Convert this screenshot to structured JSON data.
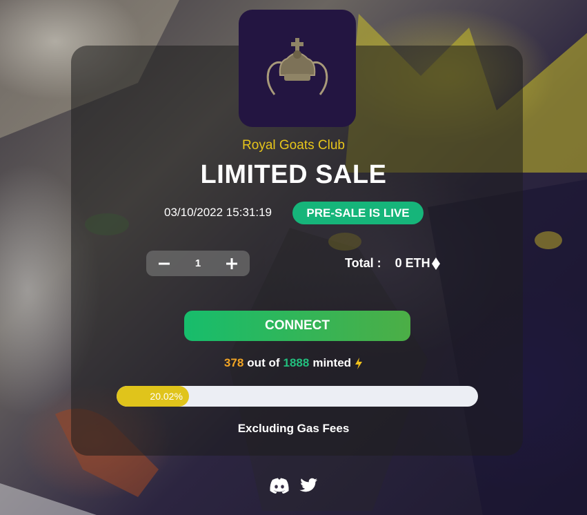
{
  "header": {
    "club_name": "Royal Goats Club",
    "title": "LIMITED SALE"
  },
  "sale": {
    "datetime": "03/10/2022 15:31:19",
    "status": "PRE-SALE IS LIVE"
  },
  "mint": {
    "quantity": "1",
    "minus_label": "−",
    "plus_label": "+",
    "total_label": "Total :",
    "total_value": "0 ETH"
  },
  "actions": {
    "connect_label": "CONNECT"
  },
  "progress": {
    "minted": "378",
    "out_of_text": "out of",
    "supply": "1888",
    "minted_text": "minted",
    "percent_label": "20.02%",
    "fraction": 0.2002
  },
  "footer": {
    "gas_note": "Excluding Gas Fees"
  },
  "icons": [
    "crown-goat-logo",
    "eth-diamond-icon",
    "lightning-icon",
    "discord-icon",
    "twitter-icon"
  ],
  "colors": {
    "accent_yellow": "#e8c61a",
    "status_green": "#16b57a",
    "minted_orange": "#f2a524",
    "supply_green": "#22c07e",
    "logo_bg": "#231541"
  }
}
